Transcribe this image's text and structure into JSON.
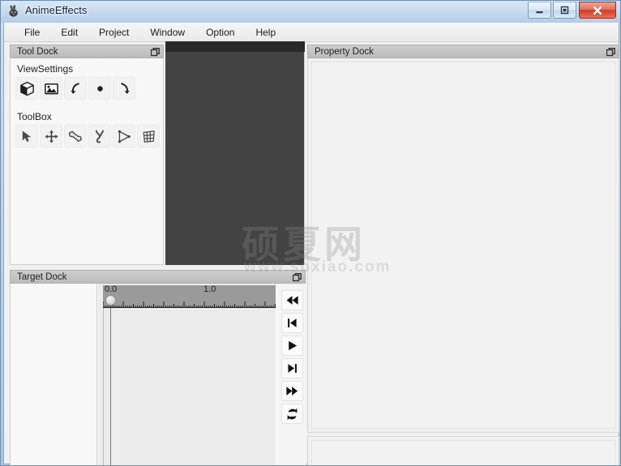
{
  "window": {
    "title": "AnimeEffects",
    "app_icon": "rabbit-app-icon",
    "controls": {
      "minimize": "minimize-button",
      "maximize": "maximize-button",
      "close": "close-button"
    },
    "frame_color": "#b4cde6",
    "titlebar_text_color": "#10243a"
  },
  "menubar": {
    "items": [
      {
        "label": "File"
      },
      {
        "label": "Edit"
      },
      {
        "label": "Project"
      },
      {
        "label": "Window"
      },
      {
        "label": "Option"
      },
      {
        "label": "Help"
      }
    ]
  },
  "tool_dock": {
    "title": "Tool Dock",
    "float_icon": "undock-icon",
    "sections": [
      {
        "label": "ViewSettings",
        "buttons": [
          {
            "name": "view-3d-cube-icon",
            "tooltip": "3D View"
          },
          {
            "name": "view-image-icon",
            "tooltip": "Image"
          },
          {
            "name": "rotate-left-icon",
            "tooltip": "Rotate Left"
          },
          {
            "name": "center-dot-icon",
            "tooltip": "Center"
          },
          {
            "name": "rotate-right-icon",
            "tooltip": "Rotate Right"
          }
        ]
      },
      {
        "label": "ToolBox",
        "buttons": [
          {
            "name": "cursor-select-icon",
            "tooltip": "Select"
          },
          {
            "name": "move-srt-icon",
            "tooltip": "Move"
          },
          {
            "name": "bone-icon",
            "tooltip": "Bone"
          },
          {
            "name": "bone-pose-icon",
            "tooltip": "Pose"
          },
          {
            "name": "mesh-triangle-icon",
            "tooltip": "Mesh"
          },
          {
            "name": "mesh-grid-icon",
            "tooltip": "FFD"
          }
        ]
      }
    ]
  },
  "canvas": {
    "name": "main-canvas",
    "background_color": "#434343",
    "top_strip_color": "#2a2a2a"
  },
  "watermark": {
    "cn_text": "硕夏网",
    "url_text": "www.soxiao.com"
  },
  "property_dock": {
    "title": "Property Dock",
    "float_icon": "undock-icon"
  },
  "target_dock": {
    "title": "Target Dock",
    "float_icon": "undock-icon",
    "timeline": {
      "labels": [
        {
          "text": "0.0",
          "pos": 0
        },
        {
          "text": "1.0",
          "pos": 125
        }
      ],
      "playhead_value": "0.0",
      "ruler_color": "#9a9a9a"
    },
    "playback_buttons": [
      {
        "name": "rewind-to-start-button",
        "label": "Rewind To Start"
      },
      {
        "name": "step-backward-button",
        "label": "Step Backward"
      },
      {
        "name": "play-button",
        "label": "Play"
      },
      {
        "name": "step-forward-button",
        "label": "Step Forward"
      },
      {
        "name": "fast-forward-to-end-button",
        "label": "Fast Forward To End"
      },
      {
        "name": "loop-button",
        "label": "Loop"
      }
    ]
  }
}
